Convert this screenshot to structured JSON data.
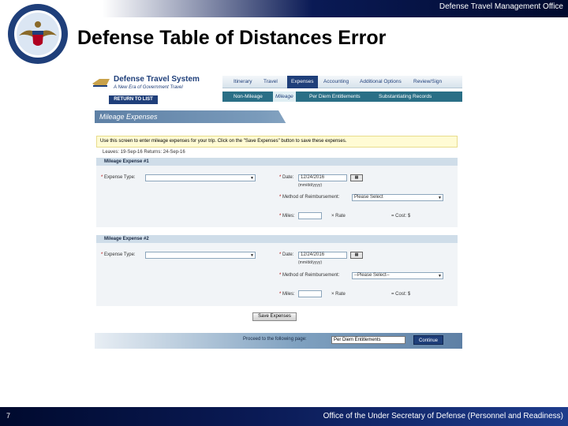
{
  "slide": {
    "header_org": "Defense Travel Management Office",
    "title": "Defense Table of Distances Error",
    "page_number": "7",
    "footer": "Office of the Under Secretary of Defense (Personnel and Readiness)"
  },
  "dts": {
    "brand": "Defense Travel System",
    "tagline": "A New Era of Government Travel",
    "return_label": "RETURN TO LIST",
    "nav1": [
      "Itinerary",
      "Travel",
      "Expenses",
      "Accounting",
      "Additional Options",
      "Review/Sign"
    ],
    "nav1_active": "Expenses",
    "nav2": [
      "Non-Mileage",
      "Mileage",
      "Per Diem Entitlements",
      "Substantiating Records"
    ],
    "nav2_active": "Mileage",
    "section_title": "Mileage Expenses",
    "info_text": "Use this screen to enter mileage expenses for your trip. Click on the \"Save Expenses\" button to save these expenses.",
    "dates_text": "Leaves: 19-Sep-16    Returns: 24-Sep-16",
    "labels": {
      "expense_type": "Expense Type:",
      "date": "Date:",
      "date_format": "(mm/dd/yyyy)",
      "method": "Method of Reimbursement:",
      "miles": "Miles:",
      "rate": "Rate",
      "cost": "Cost: $"
    },
    "expenses": [
      {
        "header": "Mileage Expense #1",
        "expense_type_value": "",
        "date_value": "12/24/2016",
        "method_value": "Please Select",
        "miles_value": ""
      },
      {
        "header": "Mileage Expense #2",
        "expense_type_value": "",
        "date_value": "12/24/2016",
        "method_value": "--Please Select--",
        "miles_value": ""
      }
    ],
    "save_label": "Save Expenses",
    "proceed_label": "Proceed to the following page:",
    "proceed_value": "Per Diem Entitlements",
    "continue_label": "Continue"
  },
  "colors": {
    "dts_navy": "#1f3f7a",
    "dts_teal": "#2a6f86",
    "info_yellow": "#fffbd4",
    "slide_navy": "#0a1a55"
  }
}
